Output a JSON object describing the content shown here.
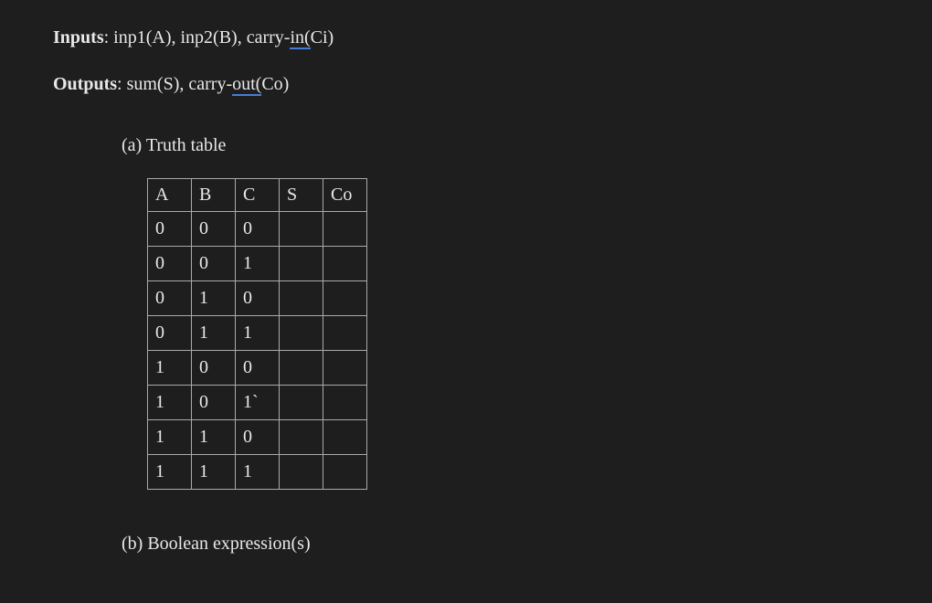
{
  "inputs": {
    "label": "Inputs",
    "prefix": ": inp1(A), inp2(B), carry-",
    "underlined": "in(",
    "suffix": "Ci)"
  },
  "outputs": {
    "label": "Outputs",
    "prefix": ": sum(S), carry-",
    "underlined": "out(",
    "suffix": "Co)"
  },
  "section_a": "(a)  Truth table",
  "section_b": "(b)  Boolean expression(s)",
  "chart_data": {
    "type": "table",
    "headers": [
      "A",
      "B",
      "C",
      "S",
      "Co"
    ],
    "rows": [
      [
        "0",
        "0",
        "0",
        "",
        ""
      ],
      [
        "0",
        "0",
        "1",
        "",
        ""
      ],
      [
        "0",
        "1",
        "0",
        "",
        ""
      ],
      [
        "0",
        "1",
        "1",
        "",
        ""
      ],
      [
        "1",
        "0",
        "0",
        "",
        ""
      ],
      [
        "1",
        "0",
        "1`",
        "",
        ""
      ],
      [
        "1",
        "1",
        "0",
        "",
        ""
      ],
      [
        "1",
        "1",
        "1",
        "",
        ""
      ]
    ]
  }
}
